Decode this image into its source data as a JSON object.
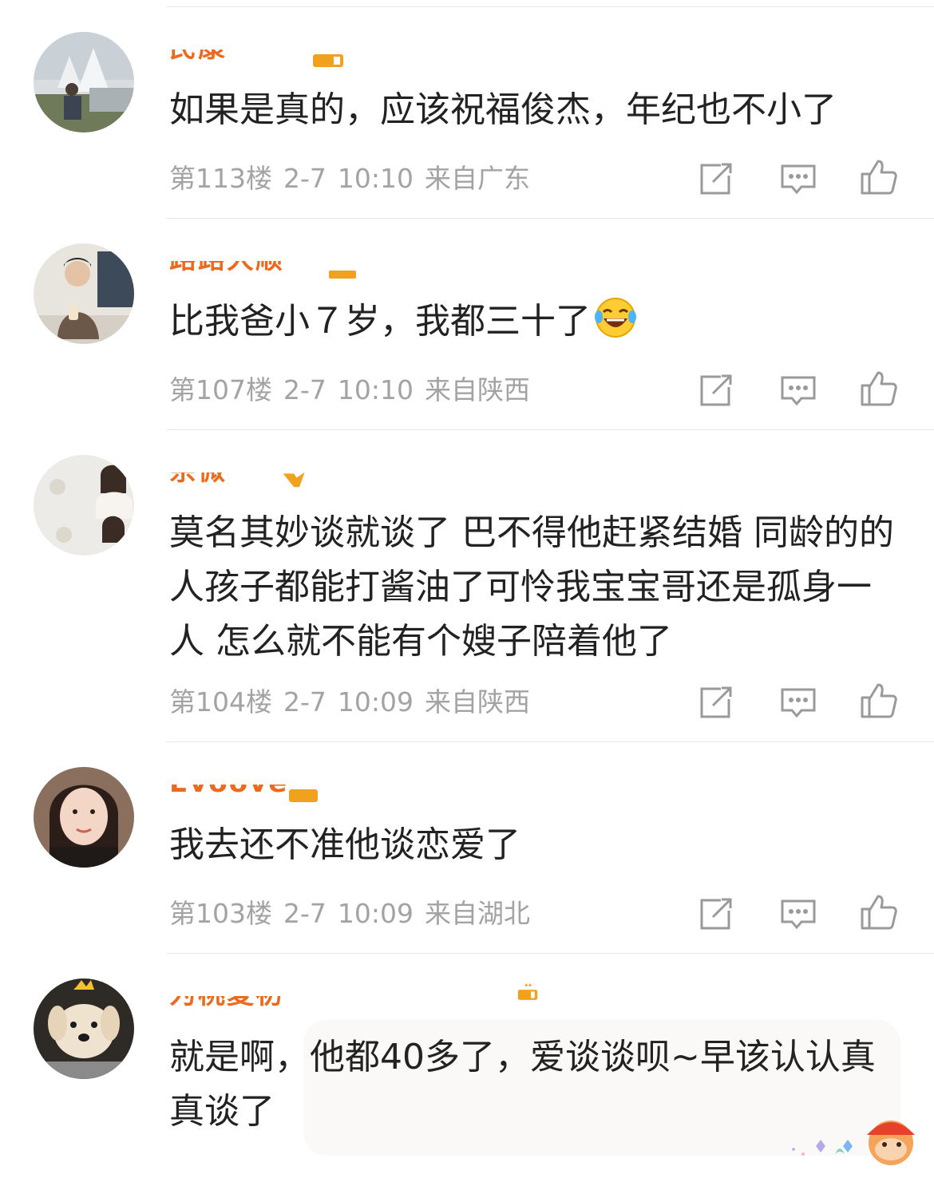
{
  "comments": [
    {
      "username": "民康",
      "text": "如果是真的，应该祝福俊杰，年纪也不小了",
      "floor": "第113楼",
      "date": "2-7",
      "time": "10:10",
      "location": "来自广东"
    },
    {
      "username": "路路大顺",
      "text": "比我爸小７岁，我都三十了",
      "emoji": "laughing-tears-emoji",
      "floor": "第107楼",
      "date": "2-7",
      "time": "10:10",
      "location": "来自陕西"
    },
    {
      "username": "余微",
      "text": "莫名其妙谈就谈了 巴不得他赶紧结婚 同龄的的人孩子都能打酱油了可怜我宝宝哥还是孤身一人 怎么就不能有个嫂子陪着他了",
      "floor": "第104楼",
      "date": "2-7",
      "time": "10:09",
      "location": "来自陕西"
    },
    {
      "username": "Evoove",
      "text": "我去还不准他谈恋爱了",
      "floor": "第103楼",
      "date": "2-7",
      "time": "10:09",
      "location": "来自湖北"
    },
    {
      "username": "为桃夏初",
      "text": "就是啊，他都40多了，爱谈谈呗~早该认认真真谈了"
    }
  ],
  "actions": {
    "repost_icon": "repost-icon",
    "comment_icon": "comment-icon",
    "like_icon": "thumbs-up-icon"
  },
  "colors": {
    "username": "#ec6a1e",
    "meta": "#a3a3a3",
    "text": "#222222",
    "divider": "#e6e6e6"
  }
}
